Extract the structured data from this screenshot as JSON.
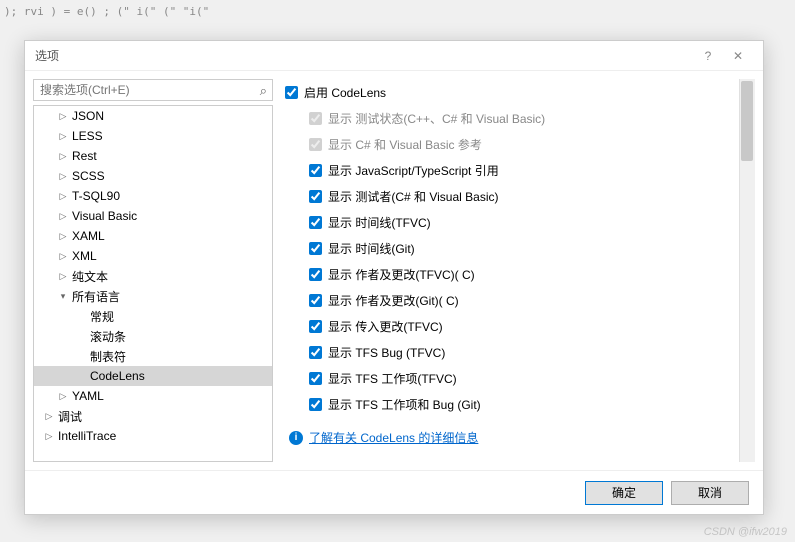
{
  "background_code": ");\n\nrvi\n) =\n\ne()\n\n;\n(\"\ni(\"\n(\"\n\"i(\"",
  "dialog": {
    "title": "选项",
    "search_placeholder": "搜索选项(Ctrl+E)"
  },
  "tree": [
    {
      "label": "JSON",
      "indent": 1,
      "arrow": "right"
    },
    {
      "label": "LESS",
      "indent": 1,
      "arrow": "right"
    },
    {
      "label": "Rest",
      "indent": 1,
      "arrow": "right"
    },
    {
      "label": "SCSS",
      "indent": 1,
      "arrow": "right"
    },
    {
      "label": "T-SQL90",
      "indent": 1,
      "arrow": "right"
    },
    {
      "label": "Visual Basic",
      "indent": 1,
      "arrow": "right"
    },
    {
      "label": "XAML",
      "indent": 1,
      "arrow": "right"
    },
    {
      "label": "XML",
      "indent": 1,
      "arrow": "right"
    },
    {
      "label": "纯文本",
      "indent": 1,
      "arrow": "right"
    },
    {
      "label": "所有语言",
      "indent": 1,
      "arrow": "down"
    },
    {
      "label": "常规",
      "indent": 2,
      "arrow": ""
    },
    {
      "label": "滚动条",
      "indent": 2,
      "arrow": ""
    },
    {
      "label": "制表符",
      "indent": 2,
      "arrow": ""
    },
    {
      "label": "CodeLens",
      "indent": 2,
      "arrow": "",
      "selected": true
    },
    {
      "label": "YAML",
      "indent": 1,
      "arrow": "right"
    },
    {
      "label": "调试",
      "indent": 0,
      "arrow": "right"
    },
    {
      "label": "IntelliTrace",
      "indent": 0,
      "arrow": "right"
    }
  ],
  "options": {
    "main": {
      "label": "启用 CodeLens",
      "checked": true
    },
    "children": [
      {
        "label": "显示 测试状态(C++、C# 和 Visual Basic)",
        "checked": true,
        "disabled": true
      },
      {
        "label": "显示 C# 和 Visual Basic 参考",
        "checked": true,
        "disabled": true
      },
      {
        "label": "显示 JavaScript/TypeScript 引用",
        "checked": true
      },
      {
        "label": "显示 测试者(C# 和 Visual Basic)",
        "checked": true
      },
      {
        "label": "显示 时间线(TFVC)",
        "checked": true
      },
      {
        "label": "显示 时间线(Git)",
        "checked": true
      },
      {
        "label": "显示 作者及更改(TFVC)( C)",
        "checked": true
      },
      {
        "label": "显示 作者及更改(Git)( C)",
        "checked": true
      },
      {
        "label": "显示 传入更改(TFVC)",
        "checked": true
      },
      {
        "label": "显示 TFS Bug (TFVC)",
        "checked": true
      },
      {
        "label": "显示 TFS 工作项(TFVC)",
        "checked": true
      },
      {
        "label": "显示 TFS 工作项和 Bug (Git)",
        "checked": true
      }
    ]
  },
  "link": "了解有关 CodeLens 的详细信息",
  "buttons": {
    "ok": "确定",
    "cancel": "取消"
  },
  "watermark": "CSDN @ifw2019"
}
